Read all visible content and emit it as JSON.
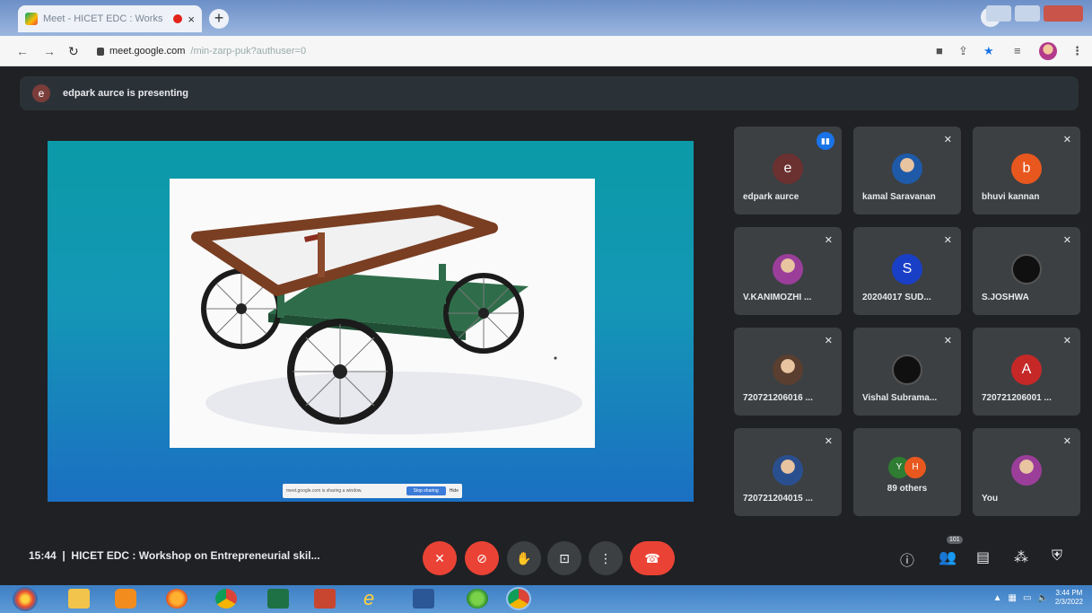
{
  "browser": {
    "tab_title": "Meet - HICET EDC : Works",
    "tab_close": "×",
    "new_tab": "+",
    "url_host": "meet.google.com",
    "url_path": "/min-zarp-puk?authuser=0",
    "profile_menu": "⌄"
  },
  "meet": {
    "presenting_initial": "e",
    "presenting_text": "edpark aurce is presenting",
    "share_bar": {
      "text": "meet.google.com is sharing a window.",
      "stop": "Stop sharing",
      "hide": "Hide"
    },
    "participants": [
      {
        "name": "edpark aurce",
        "initial": "e",
        "color": "#6b3030",
        "speaking": true
      },
      {
        "name": "kamal Saravanan",
        "initial": "",
        "color": "#1e5aa8",
        "photo": true
      },
      {
        "name": "bhuvi kannan",
        "initial": "b",
        "color": "#e8581e"
      },
      {
        "name": "V.KANIMOZHI ...",
        "initial": "",
        "color": "#9b3e9a",
        "photo": true
      },
      {
        "name": "20204017 SUD...",
        "initial": "S",
        "color": "#1a3fc7"
      },
      {
        "name": "S.JOSHWA",
        "initial": "",
        "color": "#111111",
        "logo": true
      },
      {
        "name": "720721206016 ...",
        "initial": "",
        "color": "#5a3e2f",
        "photo": true
      },
      {
        "name": "Vishal Subrama...",
        "initial": "",
        "color": "#202124",
        "logo": true
      },
      {
        "name": "720721206001 ...",
        "initial": "A",
        "color": "#c62828"
      },
      {
        "name": "720721204015 ...",
        "initial": "",
        "color": "#2a4f8f",
        "photo": true
      },
      {
        "name": "You",
        "initial": "",
        "color": "#9b3e9a",
        "photo": true
      }
    ],
    "others": {
      "label": "89 others",
      "initials": [
        "Y",
        "H"
      ],
      "colors": [
        "#2e7d32",
        "#e8581e"
      ]
    },
    "meeting_time": "15:44",
    "meeting_title": "HICET EDC : Workshop on Entrepreneurial skil...",
    "people_count": "101"
  },
  "taskbar": {
    "clock_time": "3:44 PM",
    "clock_date": "2/3/2022"
  }
}
